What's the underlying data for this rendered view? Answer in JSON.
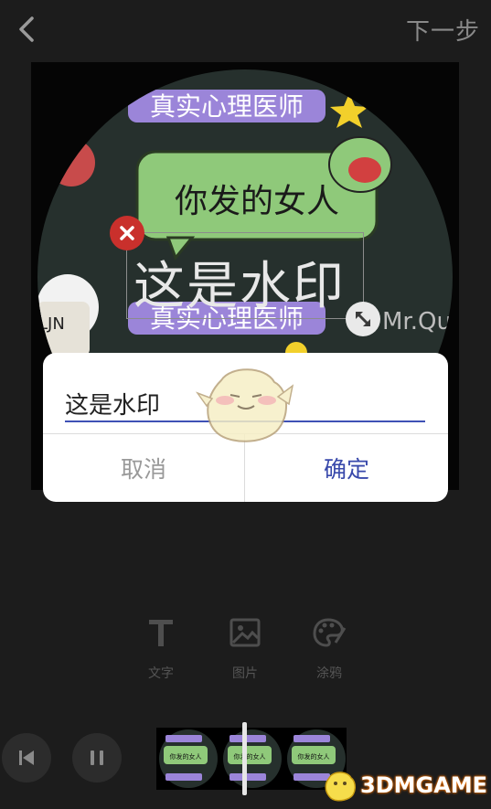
{
  "header": {
    "next_label": "下一步"
  },
  "watermark": {
    "text": "这是水印"
  },
  "image_text": {
    "banner_top": "真实心理医师",
    "bubble": "你发的女人",
    "banner_bottom": "真实心理医师",
    "signature": "Mr.Qu",
    "bear_label": "LJN"
  },
  "dialog": {
    "input_value": "这是水印",
    "cancel_label": "取消",
    "ok_label": "确定"
  },
  "tools": [
    {
      "label": "文字",
      "icon": "text-icon"
    },
    {
      "label": "图片",
      "icon": "image-icon"
    },
    {
      "label": "涂鸦",
      "icon": "palette-icon"
    }
  ],
  "timeline": {
    "thumb_caption": "你发的女人"
  },
  "brand": {
    "text": "3DMGAME"
  },
  "colors": {
    "accent": "#3949ab",
    "delete": "#c9302c",
    "bubble": "#8fc97a",
    "banner": "#9b85d9"
  }
}
